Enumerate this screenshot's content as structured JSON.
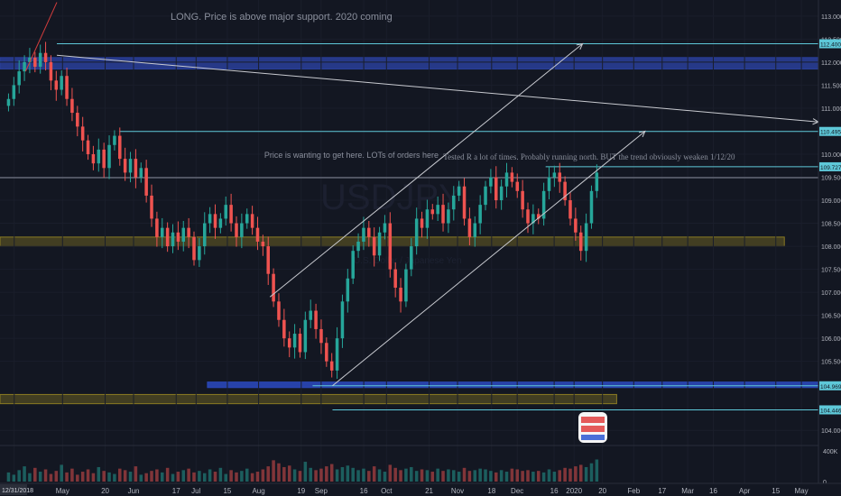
{
  "chart_data": {
    "type": "candlestick",
    "y_ticks": [
      {
        "v": 113.0,
        "label": "113.000"
      },
      {
        "v": 112.5,
        "label": "112.500"
      },
      {
        "v": 112.0,
        "label": "112.000"
      },
      {
        "v": 111.5,
        "label": "111.500"
      },
      {
        "v": 111.0,
        "label": "111.000"
      },
      {
        "v": 110.5,
        "label": "110.500"
      },
      {
        "v": 110.0,
        "label": "110.000"
      },
      {
        "v": 109.5,
        "label": "109.500"
      },
      {
        "v": 109.0,
        "label": "109.000"
      },
      {
        "v": 108.5,
        "label": "108.500"
      },
      {
        "v": 108.0,
        "label": "108.000"
      },
      {
        "v": 107.5,
        "label": "107.500"
      },
      {
        "v": 107.0,
        "label": "107.000"
      },
      {
        "v": 106.5,
        "label": "106.500"
      },
      {
        "v": 106.0,
        "label": "106.000"
      },
      {
        "v": 105.5,
        "label": "105.500"
      },
      {
        "v": 104.0,
        "label": "104.000"
      }
    ],
    "y_range": [
      103.75,
      113.35
    ],
    "x_ticks": [
      {
        "t": 0.5,
        "label": "15"
      },
      {
        "t": 2.2,
        "label": "May"
      },
      {
        "t": 3.7,
        "label": "20"
      },
      {
        "t": 4.7,
        "label": "Jun"
      },
      {
        "t": 6.2,
        "label": "17"
      },
      {
        "t": 6.9,
        "label": "Jul"
      },
      {
        "t": 8.0,
        "label": "15"
      },
      {
        "t": 9.1,
        "label": "Aug"
      },
      {
        "t": 10.6,
        "label": "19"
      },
      {
        "t": 11.3,
        "label": "Sep"
      },
      {
        "t": 12.8,
        "label": "16"
      },
      {
        "t": 13.6,
        "label": "Oct"
      },
      {
        "t": 15.1,
        "label": "21"
      },
      {
        "t": 16.1,
        "label": "Nov"
      },
      {
        "t": 17.3,
        "label": "18"
      },
      {
        "t": 18.2,
        "label": "Dec"
      },
      {
        "t": 19.5,
        "label": "16"
      },
      {
        "t": 20.2,
        "label": "2020"
      },
      {
        "t": 21.2,
        "label": "20"
      },
      {
        "t": 22.3,
        "label": "Feb"
      },
      {
        "t": 23.3,
        "label": "17"
      },
      {
        "t": 24.2,
        "label": "Mar"
      },
      {
        "t": 25.1,
        "label": "16"
      },
      {
        "t": 26.2,
        "label": "Apr"
      },
      {
        "t": 27.3,
        "label": "15"
      },
      {
        "t": 28.2,
        "label": "May"
      }
    ],
    "x_range": [
      0,
      28.8
    ],
    "left_date_label": "12/31/2018",
    "levels": [
      {
        "price": 112.4,
        "t0": 2.0,
        "t1": 28.8,
        "label": "112.400",
        "color": "#5ec8d8"
      },
      {
        "price": 110.495,
        "t0": 4.2,
        "t1": 28.8,
        "label": "110.495",
        "color": "#5ec8d8"
      },
      {
        "price": 109.727,
        "t0": 19.2,
        "t1": 28.8,
        "label": "109.727",
        "color": "#5ec8d8"
      },
      {
        "price": 109.49,
        "t0": 0.0,
        "t1": 28.8,
        "label": "",
        "color": "#8a8f9c"
      },
      {
        "price": 104.969,
        "t0": 11.0,
        "t1": 28.8,
        "label": "104.969",
        "color": "#5ec8d8"
      },
      {
        "price": 104.446,
        "t0": 11.7,
        "t1": 28.8,
        "label": "104.446",
        "color": "#5ec8d8"
      }
    ],
    "zones": [
      {
        "p_top": 112.1,
        "p_bot": 111.85,
        "t0": 0.0,
        "t1": 28.8,
        "color": "#2a3f9a",
        "alpha": 0.85
      },
      {
        "p_top": 108.2,
        "p_bot": 108.0,
        "t0": 0.0,
        "t1": 27.6,
        "color": "#8a7a22",
        "alpha": 0.4
      },
      {
        "p_top": 105.05,
        "p_bot": 104.93,
        "t0": 7.3,
        "t1": 28.8,
        "color": "#2a47b8",
        "alpha": 0.9
      },
      {
        "p_top": 104.78,
        "p_bot": 104.58,
        "t0": 0.0,
        "t1": 21.7,
        "color": "#8a7a22",
        "alpha": 0.4
      }
    ],
    "trend_lines": [
      {
        "t0": 9.5,
        "p0": 106.9,
        "t1": 20.5,
        "p1": 112.4,
        "color": "#c8cad0",
        "arrow": true
      },
      {
        "t0": 11.7,
        "p0": 104.97,
        "t1": 22.7,
        "p1": 110.5,
        "color": "#c8cad0",
        "arrow": true
      },
      {
        "t0": 2.0,
        "p0": 112.15,
        "t1": 28.8,
        "p1": 110.7,
        "color": "#c8cad0",
        "arrow": true
      },
      {
        "t0": 0.9,
        "p0": 111.8,
        "t1": 2.0,
        "p1": 113.3,
        "color": "#d23c3c",
        "arrow": false
      }
    ],
    "last_price": {
      "t": 22.5,
      "label": "USDJPY"
    },
    "volume_axis": [
      {
        "v": 400,
        "label": "400K"
      },
      {
        "v": 0,
        "label": "0"
      }
    ],
    "annotations": [
      {
        "t": 6.0,
        "p": 112.92,
        "text": "LONG. Price is above major support. 2020 coming"
      },
      {
        "t": 9.3,
        "p": 109.92,
        "text": "Price is wanting to get here. LOTs of orders here"
      },
      {
        "t": 15.6,
        "p": 109.88,
        "text": "Tested R a lot of times. Probably running north. BUT the trend obviously weaken 1/12/20"
      }
    ],
    "watermark": "USDJPY",
    "watermark_sub": "U.S. Dollar / Japanese Yen",
    "closes": [
      111.2,
      111.5,
      111.8,
      112.0,
      112.1,
      111.9,
      112.2,
      112.0,
      111.6,
      111.4,
      111.7,
      111.2,
      110.9,
      110.6,
      110.3,
      110.0,
      109.8,
      110.1,
      109.7,
      110.2,
      110.4,
      109.9,
      109.6,
      109.9,
      109.5,
      109.7,
      109.1,
      108.6,
      108.2,
      108.4,
      108.0,
      108.3,
      108.1,
      108.4,
      108.2,
      107.7,
      108.0,
      108.5,
      108.7,
      108.4,
      108.6,
      108.9,
      108.5,
      108.2,
      108.5,
      108.7,
      108.4,
      108.1,
      108.0,
      107.4,
      106.8,
      106.4,
      106.0,
      105.8,
      106.1,
      105.7,
      106.4,
      106.6,
      106.2,
      105.9,
      105.5,
      105.3,
      106.0,
      106.8,
      107.3,
      107.9,
      108.1,
      108.4,
      108.2,
      107.8,
      108.3,
      108.5,
      107.5,
      107.1,
      106.8,
      107.5,
      108.0,
      108.6,
      108.4,
      108.8,
      108.7,
      108.9,
      108.5,
      108.8,
      109.1,
      109.3,
      108.6,
      108.2,
      108.5,
      108.9,
      109.3,
      109.5,
      109.0,
      109.3,
      109.6,
      109.4,
      109.2,
      108.8,
      108.5,
      108.7,
      108.6,
      109.2,
      109.5,
      109.6,
      109.4,
      109.0,
      108.6,
      108.3,
      107.9,
      108.5,
      109.2,
      109.6
    ],
    "volumes": [
      120,
      90,
      150,
      200,
      110,
      180,
      130,
      160,
      100,
      140,
      220,
      120,
      170,
      90,
      130,
      160,
      110,
      190,
      140,
      120,
      100,
      170,
      150,
      130,
      200,
      90,
      110,
      140,
      160,
      120,
      180,
      100,
      130,
      150,
      170,
      120,
      140,
      110,
      160,
      130,
      180,
      100,
      150,
      120,
      140,
      170,
      110,
      130,
      160,
      200,
      280,
      240,
      190,
      210,
      160,
      140,
      260,
      180,
      150,
      170,
      200,
      230,
      160,
      190,
      210,
      180,
      150,
      170,
      140,
      200,
      160,
      130,
      220,
      180,
      150,
      170,
      190,
      140,
      160,
      150,
      130,
      170,
      140,
      160,
      150,
      130,
      180,
      140,
      150,
      170,
      160,
      140,
      120,
      150,
      130,
      170,
      160,
      140,
      150,
      130,
      140,
      120,
      160,
      130,
      150,
      180,
      170,
      200,
      220,
      190,
      240,
      290
    ]
  }
}
